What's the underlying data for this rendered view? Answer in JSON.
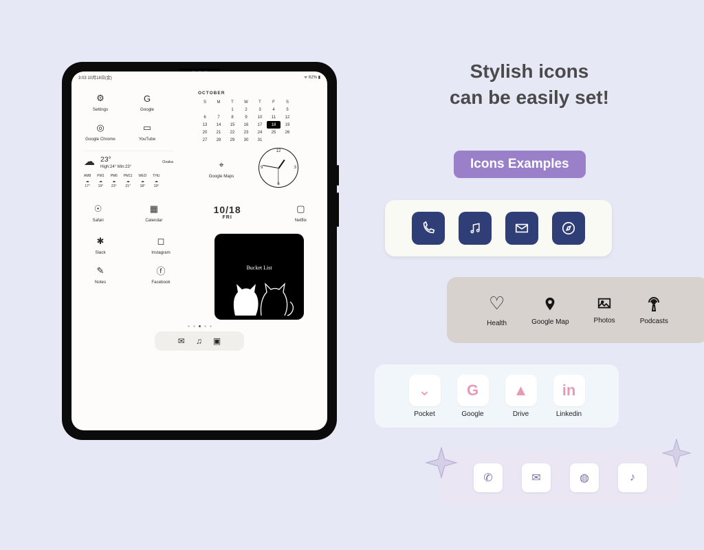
{
  "headline_line1": "Stylish icons",
  "headline_line2": "can be easily set!",
  "badge": "Icons Examples",
  "statusbar": {
    "left": "3:03  10月18日(金)",
    "right": "ᯤ 62% ▮"
  },
  "apps": {
    "settings": "Settings",
    "google": "Google",
    "chrome": "Google Chrome",
    "youtube": "YouTube",
    "maps": "Google Maps",
    "safari": "Safari",
    "calendar": "Calendar",
    "netflix": "Netflix",
    "slack": "Slack",
    "instagram": "Instagram",
    "notes": "Notes",
    "facebook": "Facebook"
  },
  "calendar": {
    "month": "OCTOBER",
    "dow": [
      "S",
      "M",
      "T",
      "W",
      "T",
      "F",
      "S"
    ],
    "weeks": [
      [
        "",
        "",
        "1",
        "2",
        "3",
        "4",
        "5"
      ],
      [
        "6",
        "7",
        "8",
        "9",
        "10",
        "11",
        "12"
      ],
      [
        "13",
        "14",
        "15",
        "16",
        "17",
        "18",
        "19"
      ],
      [
        "20",
        "21",
        "22",
        "23",
        "24",
        "25",
        "26"
      ],
      [
        "27",
        "28",
        "29",
        "30",
        "31",
        "",
        ""
      ]
    ],
    "today": "18"
  },
  "weather": {
    "city": "Osaka",
    "temp": "23°",
    "hilo": "High:24° Min:23°",
    "hours": [
      {
        "h": "AM8",
        "t": "17°"
      },
      {
        "h": "PM1",
        "t": "19°"
      },
      {
        "h": "PM6",
        "t": "23°"
      },
      {
        "h": "PM11",
        "t": "21°"
      },
      {
        "h": "WED",
        "t": "18°"
      },
      {
        "h": "THU",
        "t": "19°"
      }
    ]
  },
  "datewidget": {
    "date": "10/18",
    "day": "FRI"
  },
  "bucket": {
    "title": "Bucket List"
  },
  "ex2": {
    "health": "Health",
    "googlemap": "Google Map",
    "photos": "Photos",
    "podcasts": "Podcasts"
  },
  "ex3": {
    "pocket": "Pocket",
    "google": "Google",
    "drive": "Drive",
    "linkedin": "Linkedin"
  }
}
